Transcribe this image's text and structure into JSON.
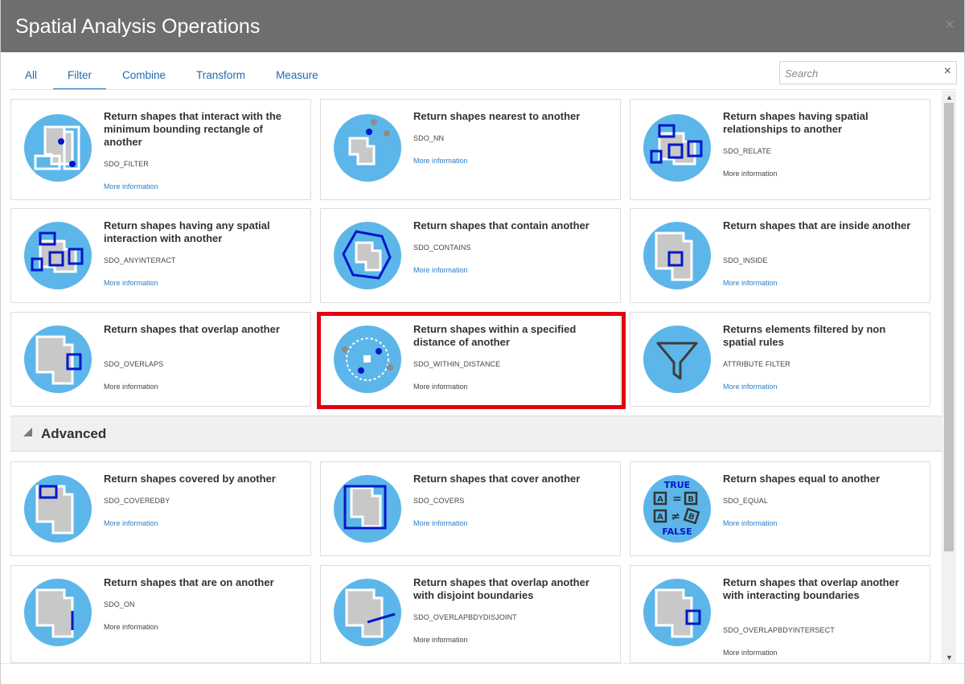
{
  "dialog": {
    "title": "Spatial Analysis Operations",
    "close_glyph": "×"
  },
  "tabs": [
    {
      "label": "All",
      "active": false
    },
    {
      "label": "Filter",
      "active": true
    },
    {
      "label": "Combine",
      "active": false
    },
    {
      "label": "Transform",
      "active": false
    },
    {
      "label": "Measure",
      "active": false
    }
  ],
  "search": {
    "placeholder": "Search",
    "clear_glyph": "×"
  },
  "filter_cards": [
    {
      "title": "Return shapes that interact with the minimum bounding rectangle of another",
      "code": "SDO_FILTER",
      "more": "More information",
      "icon": "filter-mbr-icon"
    },
    {
      "title": "Return shapes nearest to another",
      "code": "SDO_NN",
      "more": "More information",
      "icon": "nearest-neighbor-icon"
    },
    {
      "title": "Return shapes having spatial relationships to another",
      "code": "SDO_RELATE",
      "more": "More information",
      "icon": "relate-icon"
    },
    {
      "title": "Return shapes having any spatial interaction with another",
      "code": "SDO_ANYINTERACT",
      "more": "More information",
      "icon": "anyinteract-icon"
    },
    {
      "title": "Return shapes that contain another",
      "code": "SDO_CONTAINS",
      "more": "More information",
      "icon": "contains-icon"
    },
    {
      "title": "Return shapes that are inside another",
      "code": "SDO_INSIDE",
      "more": "More information",
      "icon": "inside-icon"
    },
    {
      "title": "Return shapes that overlap another",
      "code": "SDO_OVERLAPS",
      "more": "More information",
      "icon": "overlaps-icon"
    },
    {
      "title": "Return shapes within a specified distance of another",
      "code": "SDO_WITHIN_DISTANCE",
      "more": "More information",
      "icon": "within-distance-icon"
    },
    {
      "title": "Returns elements filtered by non spatial rules",
      "code": "ATTRIBUTE FILTER",
      "more": "More information",
      "icon": "funnel-icon"
    }
  ],
  "advanced": {
    "label": "Advanced"
  },
  "advanced_cards": [
    {
      "title": "Return shapes covered by another",
      "code": "SDO_COVEREDBY",
      "more": "More information",
      "icon": "coveredby-icon"
    },
    {
      "title": "Return shapes that cover another",
      "code": "SDO_COVERS",
      "more": "More information",
      "icon": "covers-icon"
    },
    {
      "title": "Return shapes equal to another",
      "code": "SDO_EQUAL",
      "more": "More information",
      "icon": "equal-icon",
      "icon_text_true": "TRUE",
      "icon_text_false": "FALSE",
      "icon_text_a": "A",
      "icon_text_b": "B",
      "icon_text_eq": "=",
      "icon_text_neq": "≠"
    },
    {
      "title": "Return shapes that are on another",
      "code": "SDO_ON",
      "more": "More information",
      "icon": "on-icon"
    },
    {
      "title": "Return shapes that overlap another with disjoint boundaries",
      "code": "SDO_OVERLAPBDYDISJOINT",
      "more": "More information",
      "icon": "overlap-disjoint-icon"
    },
    {
      "title": "Return shapes that overlap another with interacting boundaries",
      "code": "SDO_OVERLAPBDYINTERSECT",
      "more": "More information",
      "icon": "overlap-intersect-icon"
    }
  ],
  "scrollbar": {
    "up_glyph": "▲",
    "down_glyph": "▼"
  },
  "colors": {
    "titlebar": "#6e6e6e",
    "icon_circle": "#5db6e9",
    "link": "#2d7cc4",
    "shape_fill": "#c8c8c8",
    "accent_blue": "#0018c8",
    "highlight": "#e3000f"
  }
}
